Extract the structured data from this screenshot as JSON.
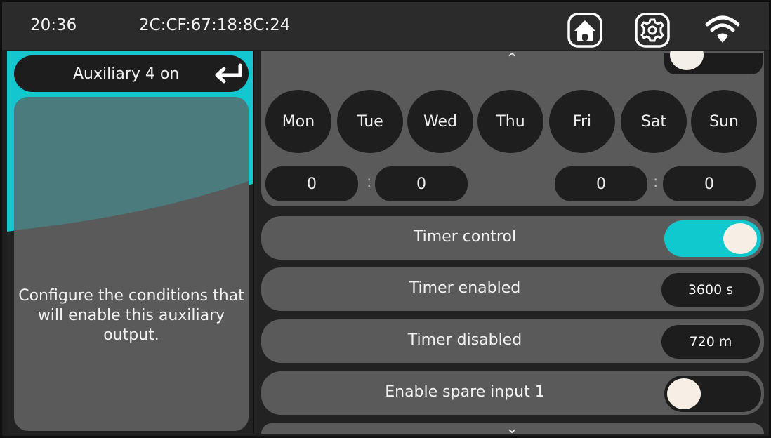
{
  "status_bar": {
    "time": "20:36",
    "mac_address": "2C:CF:67:18:8C:24",
    "icons": [
      "home-icon",
      "gear-icon",
      "wifi-icon"
    ]
  },
  "left_panel": {
    "title": "Auxiliary 4 on",
    "back_icon": "return-arrow-icon",
    "description": "Configure the conditions that will enable this auxiliary output."
  },
  "schedule": {
    "days": [
      "Mon",
      "Tue",
      "Wed",
      "Thu",
      "Fri",
      "Sat",
      "Sun"
    ],
    "start_time": {
      "hours": "0",
      "minutes": "0"
    },
    "end_time": {
      "hours": "0",
      "minutes": "0"
    },
    "separator": ":"
  },
  "settings": [
    {
      "label": "Timer control",
      "type": "toggle",
      "state": "on"
    },
    {
      "label": "Timer enabled",
      "type": "value",
      "value": "3600 s"
    },
    {
      "label": "Timer disabled",
      "type": "value",
      "value": "720 m"
    },
    {
      "label": "Enable spare input 1",
      "type": "toggle",
      "state": "off"
    }
  ],
  "scroll": {
    "up_glyph": "⌃",
    "down_glyph": "⌄"
  },
  "colors": {
    "accent": "#0fc9cf",
    "panel": "#5a5a5a",
    "control_bg": "#1d1d1d",
    "background": "#222222"
  }
}
